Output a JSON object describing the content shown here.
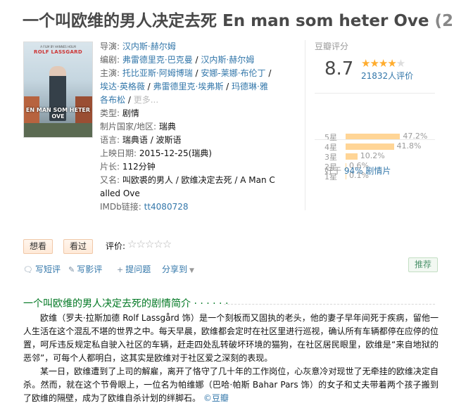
{
  "title": "一个叫欧维的男人决定去死 En man som heter Ove",
  "title_year": "(2",
  "poster": {
    "top_text": "A FILM BY HANNES HOLM",
    "actor": "ROLF LASSGARD",
    "film_title": "EN MAN SOM HETER OVE"
  },
  "info": {
    "director_label": "导演:",
    "director": "汉内斯·赫尔姆",
    "writer_label": "编剧:",
    "writers": [
      "弗雷德里克·巴克曼",
      "汉内斯·赫尔姆"
    ],
    "cast_label": "主演:",
    "cast": [
      "托比亚斯·阿姆博瑞",
      "安娜-莱娜·布伦丁",
      "埃达·英格薇",
      "弗雷德里克·埃弗斯",
      "玛德琳·雅各布松"
    ],
    "more": "更多...",
    "genre_label": "类型:",
    "genre": "剧情",
    "country_label": "制片国家/地区:",
    "country": "瑞典",
    "language_label": "语言:",
    "language": "瑞典语 / 波斯语",
    "release_label": "上映日期:",
    "release": "2015-12-25(瑞典)",
    "runtime_label": "片长:",
    "runtime": "112分钟",
    "aka_label": "又名:",
    "aka": "叫欧裘的男人 / 欧维决定去死 / A Man Called Ove",
    "imdb_label": "IMDb链接:",
    "imdb": "tt4080728"
  },
  "rating": {
    "label": "豆瓣评分",
    "score": "8.7",
    "stars": "★★★★",
    "half_star": "★",
    "votes": "21832人评价",
    "distribution": [
      {
        "label": "5星",
        "pct": "47.2%",
        "value": 47.2
      },
      {
        "label": "4星",
        "pct": "41.8%",
        "value": 41.8
      },
      {
        "label": "3星",
        "pct": "10.2%",
        "value": 10.2
      },
      {
        "label": "2星",
        "pct": "0.6%",
        "value": 0.6
      },
      {
        "label": "1星",
        "pct": "0.1%",
        "value": 0.1
      }
    ],
    "better_prefix": "好于",
    "better_link": "94% 剧情片"
  },
  "actions": {
    "want": "想看",
    "seen": "看过",
    "rate_label": "评价:",
    "rate_stars": "☆☆☆☆☆",
    "write_review_short": "写短评",
    "write_review": "写影评",
    "ask": "提问题",
    "share": "分享到",
    "recommend": "推荐"
  },
  "summary": {
    "title": "一个叫欧维的男人决定去死的剧情简介",
    "dots": "· · · · · ·",
    "p1": "欧维（罗夫·拉斯加德 Rolf Lassgård 饰）是一个刻板而又固执的老头，他的妻子早年间死于疾病，留他一人生活在这个混乱不堪的世界之中。每天早晨，欧维都会定时在社区里进行巡视，确认所有车辆都停在应停的位置，呵斥违反规定私自驶入社区的车辆，赶走四处乱转破坏环境的猫狗，在社区居民眼里，欧维是“来自地狱的恶邻”，可每个人都明白，这其实是欧维对于社区爱之深刻的表现。",
    "p2": "某一日，欧维遭到了上司的解雇，离开了恪守了几十年的工作岗位，心灰意冷对现世了无牵挂的欧维决定自杀。然而，就在这个节骨眼上，一位名为帕维娜（巴哈·帕斯 Bahar Pars 饰）的女子和丈夫带着两个孩子搬到了欧维的隔壁，成为了欧维自杀计划的绊脚石。",
    "source": "©豆瓣"
  }
}
